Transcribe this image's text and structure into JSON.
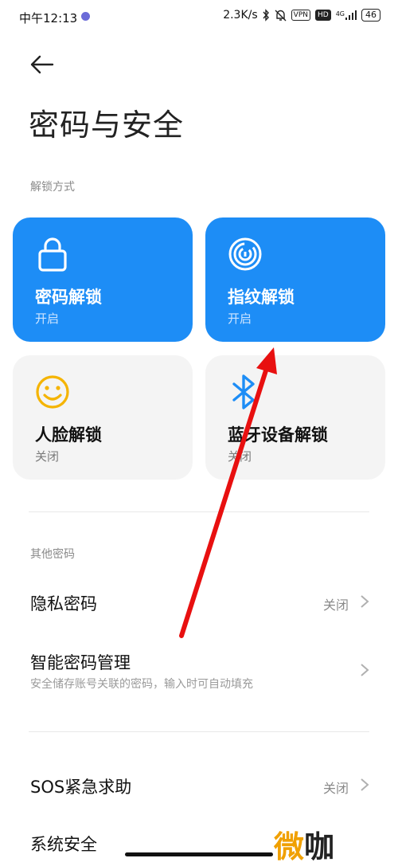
{
  "status_bar": {
    "time": "中午12:13",
    "net_speed": "2.3K/s",
    "vpn": "VPN",
    "hd": "HD",
    "signal": "4G",
    "battery": "46"
  },
  "header": {
    "title": "密码与安全"
  },
  "unlock_section": {
    "label": "解锁方式",
    "cards": [
      {
        "label": "密码解锁",
        "state": "开启",
        "icon": "lock-icon"
      },
      {
        "label": "指纹解锁",
        "state": "开启",
        "icon": "fingerprint-icon"
      },
      {
        "label": "人脸解锁",
        "state": "关闭",
        "icon": "smiley-face-icon"
      },
      {
        "label": "蓝牙设备解锁",
        "state": "关闭",
        "icon": "bluetooth-icon"
      }
    ]
  },
  "other_section": {
    "label": "其他密码",
    "privacy_password": {
      "title": "隐私密码",
      "value": "关闭"
    },
    "smart_password": {
      "title": "智能密码管理",
      "subtitle": "安全储存账号关联的密码，输入时可自动填充"
    }
  },
  "sos": {
    "title": "SOS紧急求助",
    "value": "关闭"
  },
  "system_security": {
    "title": "系统安全"
  },
  "watermark": {
    "char1": "微",
    "char2": "咖"
  },
  "colors": {
    "accent": "#1d8df6",
    "annotation_arrow": "#e81010",
    "face_icon": "#f5b400"
  }
}
